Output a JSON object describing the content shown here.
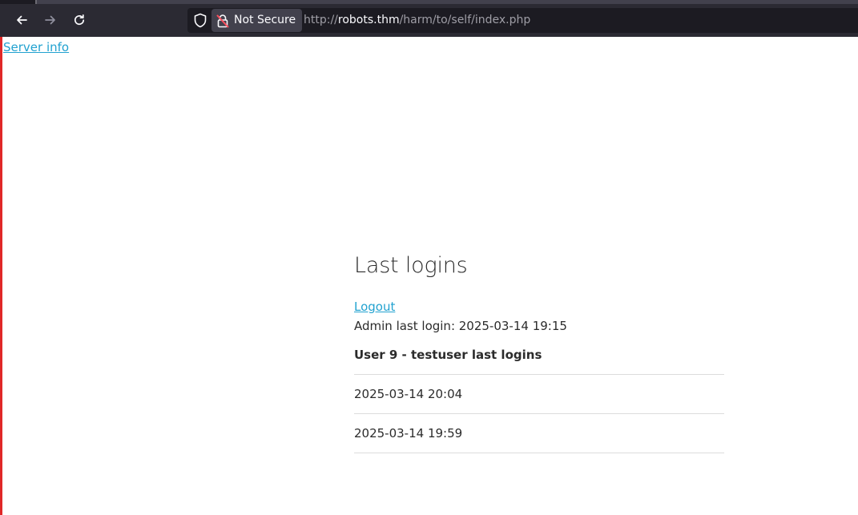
{
  "browser": {
    "back_icon": "arrow-left-icon",
    "forward_icon": "arrow-right-icon",
    "reload_icon": "reload-icon",
    "security_text": "Not Secure",
    "url_scheme": "http://",
    "url_host": "robots.thm",
    "url_path": "/harm/to/self/index.php"
  },
  "page": {
    "server_info_link": "Server info",
    "title": "Last logins",
    "logout_link": "Logout",
    "admin_last_login": "Admin last login: 2025-03-14 19:15",
    "user_heading": "User 9 - testuser last logins",
    "logins": [
      "2025-03-14 20:04",
      "2025-03-14 19:59"
    ]
  },
  "colors": {
    "link": "#22a2d0",
    "toolbar": "#2b2a33",
    "urlbar": "#1c1b22",
    "accent_edge": "#e02828"
  }
}
